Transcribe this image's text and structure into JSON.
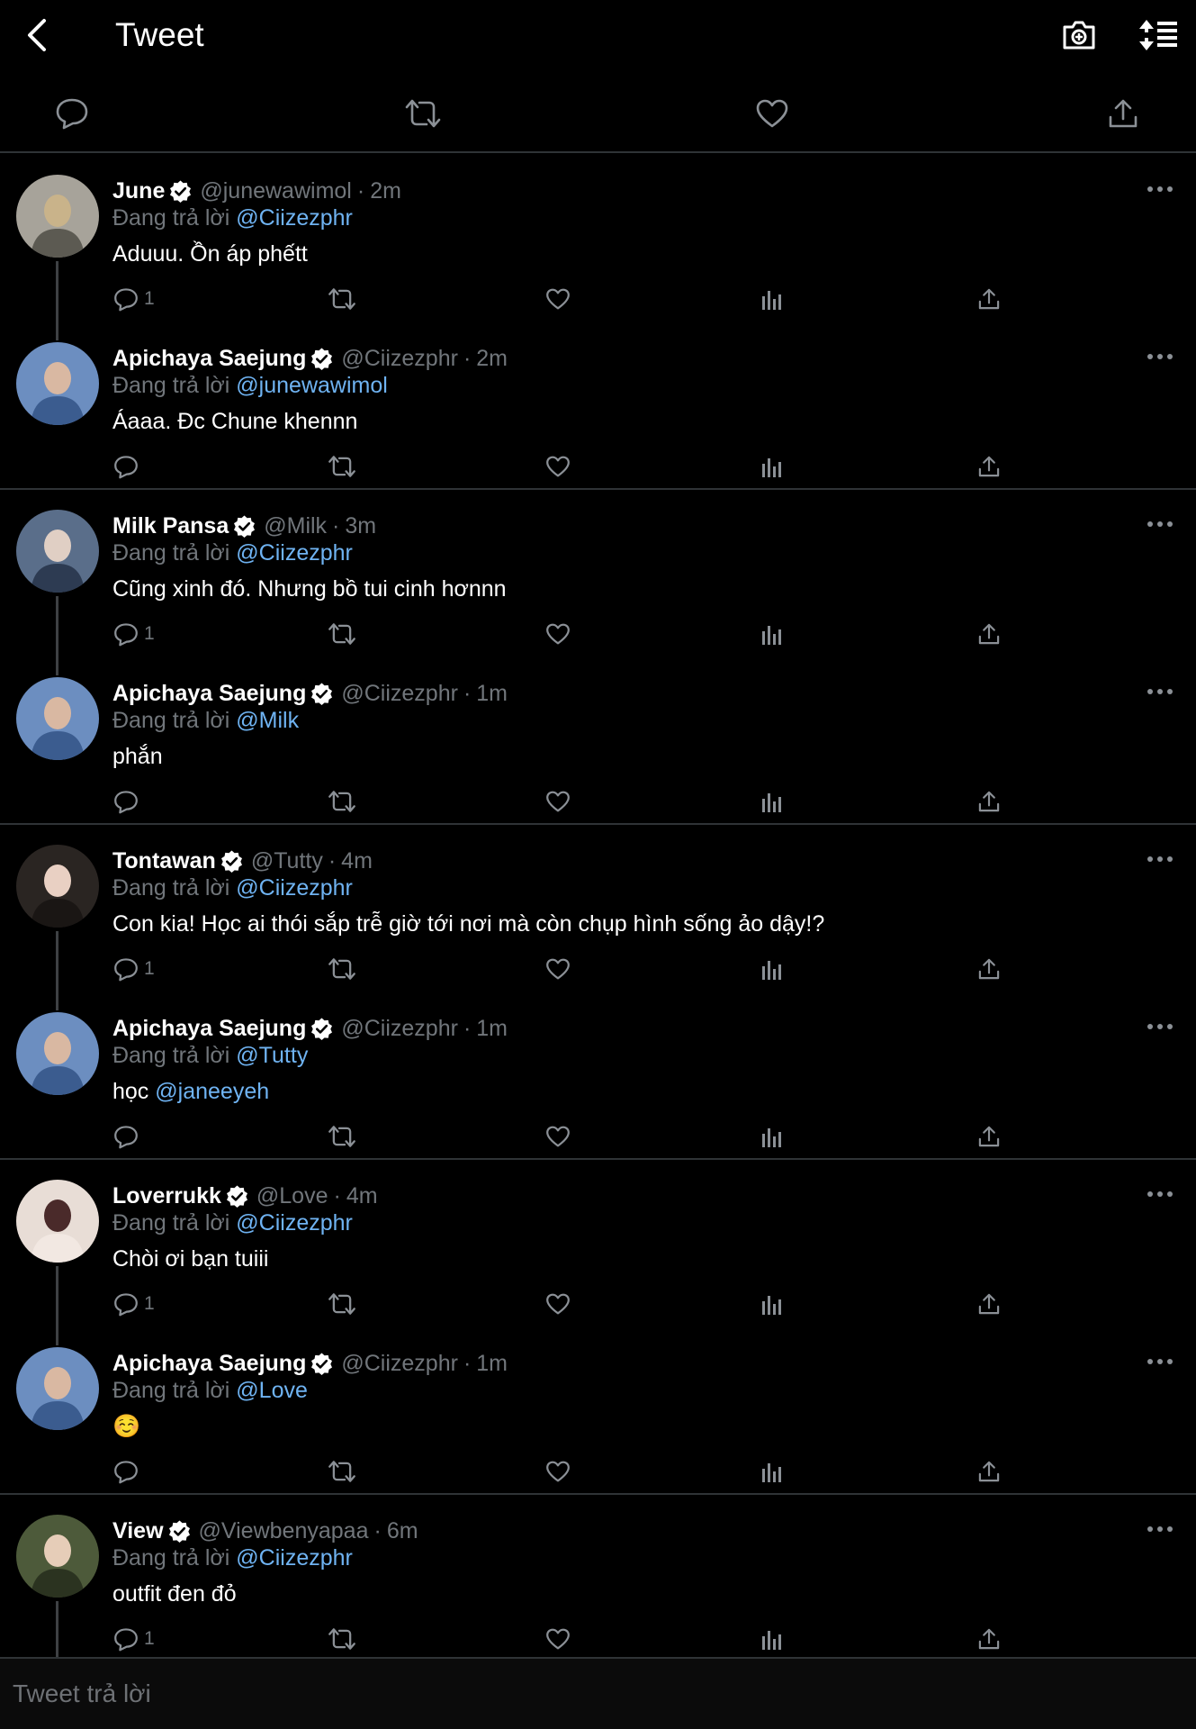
{
  "header": {
    "title": "Tweet"
  },
  "colors": {
    "background": "#000000",
    "text": "#ffffff",
    "muted": "#71767b",
    "link": "#6fb3f2",
    "divider": "#2f3336",
    "badge": "#ffffff"
  },
  "threads": [
    {
      "tweets": [
        {
          "name": "June",
          "handle": "@junewawimol",
          "time": "2m",
          "replying_label": "Đang trả lời",
          "replying_to": "@Ciizezphr",
          "text": "Aduuu. Ồn áp phếtt",
          "mention": "",
          "reply_count": "1",
          "avatar_colors": [
            "#a7a39a",
            "#c9b38a",
            "#5c5a52"
          ]
        },
        {
          "name": "Apichaya Saejung",
          "handle": "@Ciizezphr",
          "time": "2m",
          "replying_label": "Đang trả lời",
          "replying_to": "@junewawimol",
          "text": "Áaaa. Đc Chune khennn",
          "mention": "",
          "reply_count": "",
          "avatar_colors": [
            "#6c8ec0",
            "#d9b8a2",
            "#3b5c8f"
          ]
        }
      ]
    },
    {
      "tweets": [
        {
          "name": "Milk Pansa",
          "handle": "@Milk",
          "time": "3m",
          "replying_label": "Đang trả lời",
          "replying_to": "@Ciizezphr",
          "text": "Cũng xinh đó. Nhưng bồ tui cinh hơnnn",
          "mention": "",
          "reply_count": "1",
          "avatar_colors": [
            "#5a6e8a",
            "#e0cfc4",
            "#2d3b52"
          ]
        },
        {
          "name": "Apichaya Saejung",
          "handle": "@Ciizezphr",
          "time": "1m",
          "replying_label": "Đang trả lời",
          "replying_to": "@Milk",
          "text": "phắn",
          "mention": "",
          "reply_count": "",
          "avatar_colors": [
            "#6c8ec0",
            "#d9b8a2",
            "#3b5c8f"
          ]
        }
      ]
    },
    {
      "tweets": [
        {
          "name": "Tontawan",
          "handle": "@Tutty",
          "time": "4m",
          "replying_label": "Đang trả lời",
          "replying_to": "@Ciizezphr",
          "text": "Con kia! Học ai thói sắp trễ giờ tới nơi mà còn chụp hình sống ảo dậy!?",
          "mention": "",
          "reply_count": "1",
          "avatar_colors": [
            "#2a2522",
            "#e9d0c3",
            "#1a1614"
          ]
        },
        {
          "name": "Apichaya Saejung",
          "handle": "@Ciizezphr",
          "time": "1m",
          "replying_label": "Đang trả lời",
          "replying_to": "@Tutty",
          "text": "học",
          "mention": "@janeeyeh",
          "reply_count": "",
          "avatar_colors": [
            "#6c8ec0",
            "#d9b8a2",
            "#3b5c8f"
          ]
        }
      ]
    },
    {
      "tweets": [
        {
          "name": "Loverrukk",
          "handle": "@Love",
          "time": "4m",
          "replying_label": "Đang trả lời",
          "replying_to": "@Ciizezphr",
          "text": "Chòi ơi bạn tuiii",
          "mention": "",
          "reply_count": "1",
          "avatar_colors": [
            "#e8ddd6",
            "#4a2a2a",
            "#f2e8e2"
          ]
        },
        {
          "name": "Apichaya Saejung",
          "handle": "@Ciizezphr",
          "time": "1m",
          "replying_label": "Đang trả lời",
          "replying_to": "@Love",
          "text": "☺️",
          "mention": "",
          "reply_count": "",
          "avatar_colors": [
            "#6c8ec0",
            "#d9b8a2",
            "#3b5c8f"
          ]
        }
      ]
    },
    {
      "tweets": [
        {
          "name": "View",
          "handle": "@Viewbenyapaa",
          "time": "6m",
          "replying_label": "Đang trả lời",
          "replying_to": "@Ciizezphr",
          "text": "outfit đen đỏ",
          "mention": "",
          "reply_count": "1",
          "avatar_colors": [
            "#4d5a3a",
            "#e6cdb8",
            "#2b3320"
          ]
        }
      ]
    }
  ],
  "composer": {
    "placeholder": "Tweet trả lời"
  }
}
